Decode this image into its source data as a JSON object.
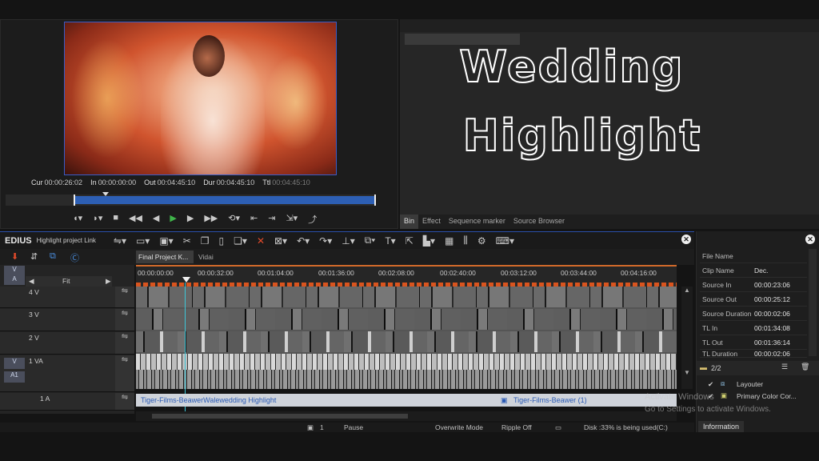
{
  "player": {
    "timecodes": [
      {
        "label": "Cur",
        "value": "00:00:26:02"
      },
      {
        "label": "In",
        "value": "00:00:00:00"
      },
      {
        "label": "Out",
        "value": "00:04:45:10"
      },
      {
        "label": "Dur",
        "value": "00:04:45:10"
      },
      {
        "label": "Ttl",
        "value": "00:04:45:10"
      }
    ],
    "transport_icons": [
      "mark-in-icon",
      "mark-out-icon",
      "stop-icon",
      "rewind-icon",
      "step-back-icon",
      "play-icon",
      "step-forward-icon",
      "fast-forward-icon",
      "loop-icon",
      "set-in-icon",
      "set-out-icon",
      "insert-icon",
      "overwrite-icon"
    ]
  },
  "bin": {
    "tabs": [
      "Bin",
      "Effect",
      "Sequence marker",
      "Source Browser"
    ],
    "active_tab": "Bin"
  },
  "overlay_title": {
    "line1": "Wedding",
    "line2": "Highlight"
  },
  "edius": {
    "logo": "EDIUS",
    "project_name": "Highlight project Link"
  },
  "timeline": {
    "sequence_tabs": [
      "Final Project K...",
      "Vidai"
    ],
    "fit_label": "Fit",
    "ruler_ticks": [
      "00:00:00:00",
      "00:00:32:00",
      "00:01:04:00",
      "00:01:36:00",
      "00:02:08:00",
      "00:02:40:00",
      "00:03:12:00",
      "00:03:44:00",
      "00:04:16:00"
    ],
    "track_labels": [
      "4 V",
      "3 V",
      "2 V",
      "1 VA",
      "1 A"
    ],
    "header_boxes": [
      "V",
      "A",
      "V",
      "A1"
    ],
    "audio_clip_1": "Tiger-Films-BeawerWalewedding Highlight",
    "audio_clip_2": "Tiger-Films-Beawer (1)"
  },
  "status": {
    "counter": "1",
    "state": "Pause",
    "mode": "Overwrite Mode",
    "ripple": "Ripple Off",
    "disk": "Disk :33% is being used(C:)"
  },
  "information": {
    "rows": [
      {
        "key": "File Name",
        "value": ""
      },
      {
        "key": "Clip Name",
        "value": "Dec."
      },
      {
        "key": "Source In",
        "value": "00:00:23:06"
      },
      {
        "key": "Source Out",
        "value": "00:00:25:12"
      },
      {
        "key": "Source Duration",
        "value": "00:00:02:06"
      },
      {
        "key": "TL In",
        "value": "00:01:34:08"
      },
      {
        "key": "TL Out",
        "value": "00:01:36:14"
      },
      {
        "key": "TL Duration",
        "value": "00:00:02:06"
      }
    ],
    "layer_count": "2/2",
    "layers": [
      "Layouter",
      "Primary Color Cor..."
    ],
    "tab": "Information"
  },
  "watermark": {
    "line1": "Activate Windows",
    "line2": "Go to Settings to activate Windows."
  },
  "colors": {
    "accent_blue": "#2d5fb4",
    "marker_orange": "#d9541e",
    "play_green": "#3fb54a"
  }
}
